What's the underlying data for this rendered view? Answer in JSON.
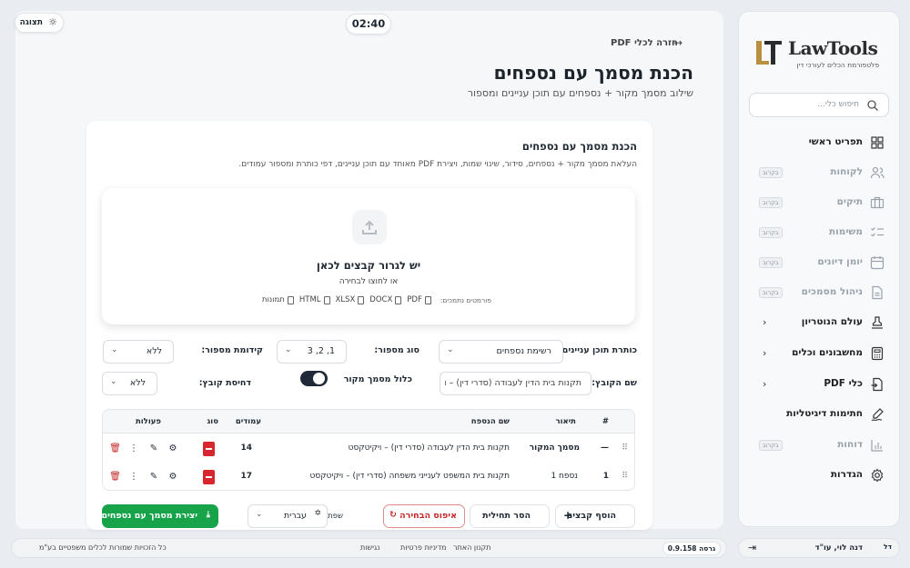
{
  "brand": {
    "name": "LawTools",
    "tagline": "פלטפורמת הכלים לעורכי דין"
  },
  "sidebar": {
    "search_placeholder": "חיפוש כלי...",
    "items": [
      {
        "label": "תפריט ראשי",
        "icon": "grid-icon"
      },
      {
        "label": "לקוחות",
        "badge": "בקרוב",
        "icon": "users-icon"
      },
      {
        "label": "תיקים",
        "badge": "בקרוב",
        "icon": "briefcase-icon"
      },
      {
        "label": "משימות",
        "badge": "בקרוב",
        "icon": "tasks-icon"
      },
      {
        "label": "יומן דיונים",
        "badge": "בקרוב",
        "icon": "calendar-icon"
      },
      {
        "label": "ניהול מסמכים",
        "badge": "בקרוב",
        "icon": "document-icon"
      },
      {
        "label": "עולם הנוטריון",
        "icon": "stamp-icon"
      },
      {
        "label": "מחשבונים וכלים",
        "icon": "calculator-icon"
      },
      {
        "label": "כלי PDF",
        "icon": "pdf-tools-icon"
      },
      {
        "label": "חתימות דיגיטליות",
        "icon": "signature-icon"
      },
      {
        "label": "דוחות",
        "badge": "בקרוב",
        "icon": "chart-icon"
      },
      {
        "label": "הגדרות",
        "icon": "gear-icon"
      }
    ]
  },
  "topbar": {
    "view_label": "תצוגה",
    "timer": "02:40"
  },
  "header": {
    "back_label": "חזרה לכלי PDF",
    "title": "הכנת מסמך עם נספחים",
    "subtitle": "שילוב מסמך מקור + נספחים עם תוכן עניינים ומספור"
  },
  "panel": {
    "title": "הכנת מסמך עם נספחים",
    "description": "העלאת מסמך מקור + נספחים, סידור, שינוי שמות, ויצירת PDF מאוחד עם תוכן עניינים, דפי כותרת ומספור עמודים.",
    "drop": {
      "title": "יש לגרור קבצים לכאן",
      "subtitle": "או לחוצו לבחירה",
      "formats_label": "פורמטים נתמכים:",
      "formats": [
        "PDF",
        "DOCX",
        "XLSX",
        "HTML",
        "תמונות"
      ]
    },
    "options": {
      "toc_title_label": "כותרת תוכן עניינים:",
      "toc_title_value": "רשימת נספחים",
      "number_type_label": "סוג מספור:",
      "number_type_value": "1, 2, 3",
      "number_prefix_label": "קידומת מספור:",
      "number_prefix_value": "ללא",
      "file_name_label": "שם הקובץ:",
      "file_name_value": "תקנות בית הדין לעבודה (סדרי דין) – וי",
      "include_source_label": "כלול מסמך מקור",
      "compress_label": "דחיסת קובץ:",
      "compress_value": "ללא"
    },
    "table": {
      "headers": [
        "#",
        "תיאור",
        "שם הנספח",
        "עמודים",
        "סוג",
        "פעולות"
      ],
      "rows": [
        {
          "num": "—",
          "desc": "מסמך המקור",
          "name": "תקנות בית הדין לעבודה (סדרי דין) – ויקיטקסט",
          "pages": "14"
        },
        {
          "num": "1",
          "desc": "נספח 1",
          "name": "תקנות בית המשפט לענייני משפחה (סדרי דין) – ויקיטקסט",
          "pages": "17"
        }
      ]
    },
    "actions": {
      "add_files": "הוסף קבצים",
      "remove_first": "הסר תחילית",
      "reset": "איפוס הבחירה",
      "language_label": "שפת הנספחים:",
      "language_value": "עברית",
      "create": "יצירת מסמך עם נספחים"
    }
  },
  "footer": {
    "copyright": "כל הזכויות שמורות לכלים משפטיים בע\"מ",
    "links": [
      "תקנון האתר",
      "מדיניות פרטיות",
      "נגישות"
    ],
    "version": "גרסה 0.9.158"
  },
  "user": {
    "initials": "דל",
    "name": "דנה לוי, עו\"ד"
  },
  "colors": {
    "accent": "#16a34a",
    "danger": "#c62828",
    "pdf": "#d7262d",
    "gold": "#b8903f"
  }
}
